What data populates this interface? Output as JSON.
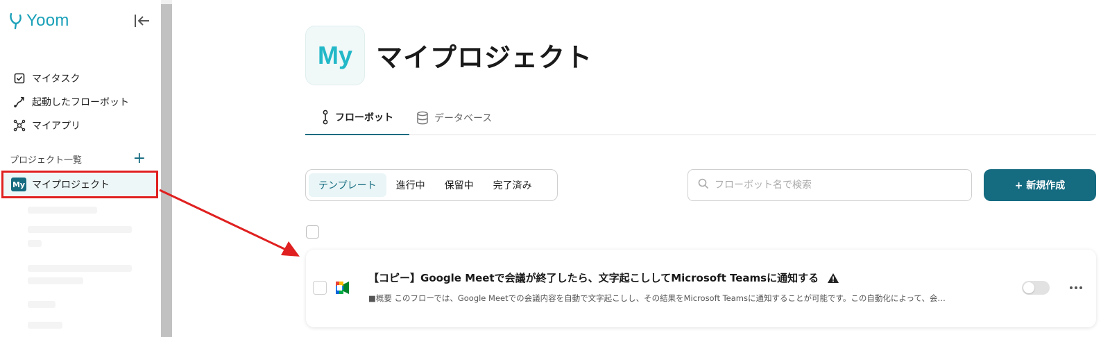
{
  "app": {
    "logo_text": "Yoom"
  },
  "sidebar": {
    "nav_items": [
      {
        "label": "マイタスク",
        "icon": "checkbox-icon"
      },
      {
        "label": "起動したフローボット",
        "icon": "route-icon"
      },
      {
        "label": "マイアプリ",
        "icon": "hub-icon"
      }
    ],
    "projects_header": "プロジェクト一覧",
    "add_project": "+",
    "active_project": {
      "badge": "My",
      "label": "マイプロジェクト"
    }
  },
  "main": {
    "title_badge": "My",
    "title": "マイプロジェクト",
    "tabs": [
      {
        "label": "フローボット",
        "icon": "flow-icon",
        "active": true
      },
      {
        "label": "データベース",
        "icon": "database-icon",
        "active": false
      }
    ],
    "filters": [
      "テンプレート",
      "進行中",
      "保留中",
      "完了済み"
    ],
    "active_filter": "テンプレート",
    "search": {
      "placeholder": "フローボット名で検索"
    },
    "new_button": "+ 新規作成",
    "flowbots": [
      {
        "title": "【コピー】Google Meetで会議が終了したら、文字起こししてMicrosoft Teamsに通知する",
        "description": "■概要 このフローでは、Google Meetでの会議内容を自動で文字起こしし、その結果をMicrosoft Teamsに通知することが可能です。この自動化によって、会…",
        "warning": true,
        "enabled": false,
        "app_icon": "google-meet-icon"
      }
    ]
  },
  "colors": {
    "brand": "#156b80",
    "logo": "#1aa0b8",
    "highlight": "#e02020"
  }
}
